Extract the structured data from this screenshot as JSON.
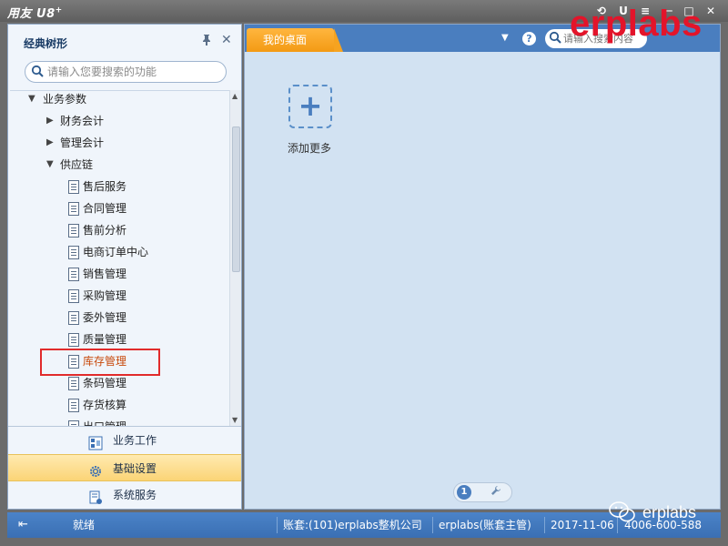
{
  "window": {
    "app_title": "用友 U8",
    "app_title_sup": "+",
    "controls": [
      "⟲",
      "U",
      "≡",
      "─",
      "□",
      "✕"
    ]
  },
  "watermark": {
    "brand": "erplabs",
    "wechat_text": "erplabs"
  },
  "left_panel": {
    "title": "经典树形",
    "search_placeholder": "请输入您要搜索的功能",
    "tree": [
      {
        "label": "业务参数",
        "level": 0,
        "expanded": true
      },
      {
        "label": "财务会计",
        "level": 1,
        "expanded": false
      },
      {
        "label": "管理会计",
        "level": 1,
        "expanded": false
      },
      {
        "label": "供应链",
        "level": 1,
        "expanded": true
      },
      {
        "label": "售后服务",
        "level": 2
      },
      {
        "label": "合同管理",
        "level": 2
      },
      {
        "label": "售前分析",
        "level": 2
      },
      {
        "label": "电商订单中心",
        "level": 2
      },
      {
        "label": "销售管理",
        "level": 2
      },
      {
        "label": "采购管理",
        "level": 2
      },
      {
        "label": "委外管理",
        "level": 2
      },
      {
        "label": "质量管理",
        "level": 2
      },
      {
        "label": "库存管理",
        "level": 2,
        "highlighted": true
      },
      {
        "label": "条码管理",
        "level": 2
      },
      {
        "label": "存货核算",
        "level": 2
      },
      {
        "label": "出口管理",
        "level": 2
      }
    ],
    "nav": [
      {
        "label": "业务工作",
        "icon": "business-work-icon",
        "active": false
      },
      {
        "label": "基础设置",
        "icon": "gear-icon",
        "active": true
      },
      {
        "label": "系统服务",
        "icon": "system-service-icon",
        "active": false
      }
    ]
  },
  "right_pane": {
    "tab_label": "我的桌面",
    "search_placeholder": "请输入搜索内容",
    "add_tile_symbol": "+",
    "add_tile_label": "添加更多",
    "current_page": "1"
  },
  "status_bar": {
    "state": "就绪",
    "account": "账套:(101)erplabs整机公司",
    "user": "erplabs(账套主管)",
    "date": "2017-11-06",
    "phone": "4006-600-588"
  },
  "colors": {
    "accent_blue": "#4a7ebf",
    "tab_orange": "#f39a14",
    "highlight_red": "#e12b2b",
    "watermark_red": "#e3142a"
  }
}
